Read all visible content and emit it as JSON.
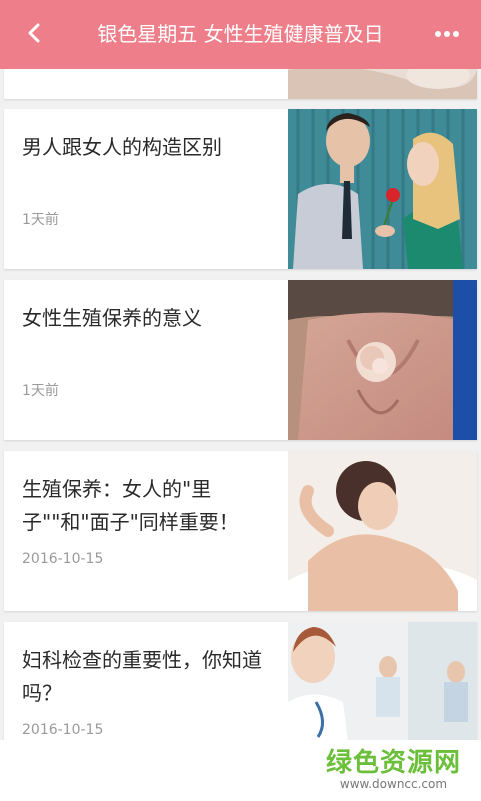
{
  "header": {
    "title": "银色星期五 女性生殖健康普及日"
  },
  "articles": [
    {
      "title": "男人跟女人的构造区别",
      "date": "1天前"
    },
    {
      "title": "女性生殖保养的意义",
      "date": "1天前"
    },
    {
      "title": "生殖保养：女人的\"里子\"\"和\"面子\"同样重要！",
      "date": "2016-10-15"
    },
    {
      "title": "妇科检查的重要性，你知道吗？",
      "date": "2016-10-15"
    }
  ],
  "watermark": {
    "main": "绿色资源网",
    "sub": "www.downcc.com"
  },
  "colors": {
    "header": "#ee7f8a",
    "watermark": "#6cbf3a"
  }
}
